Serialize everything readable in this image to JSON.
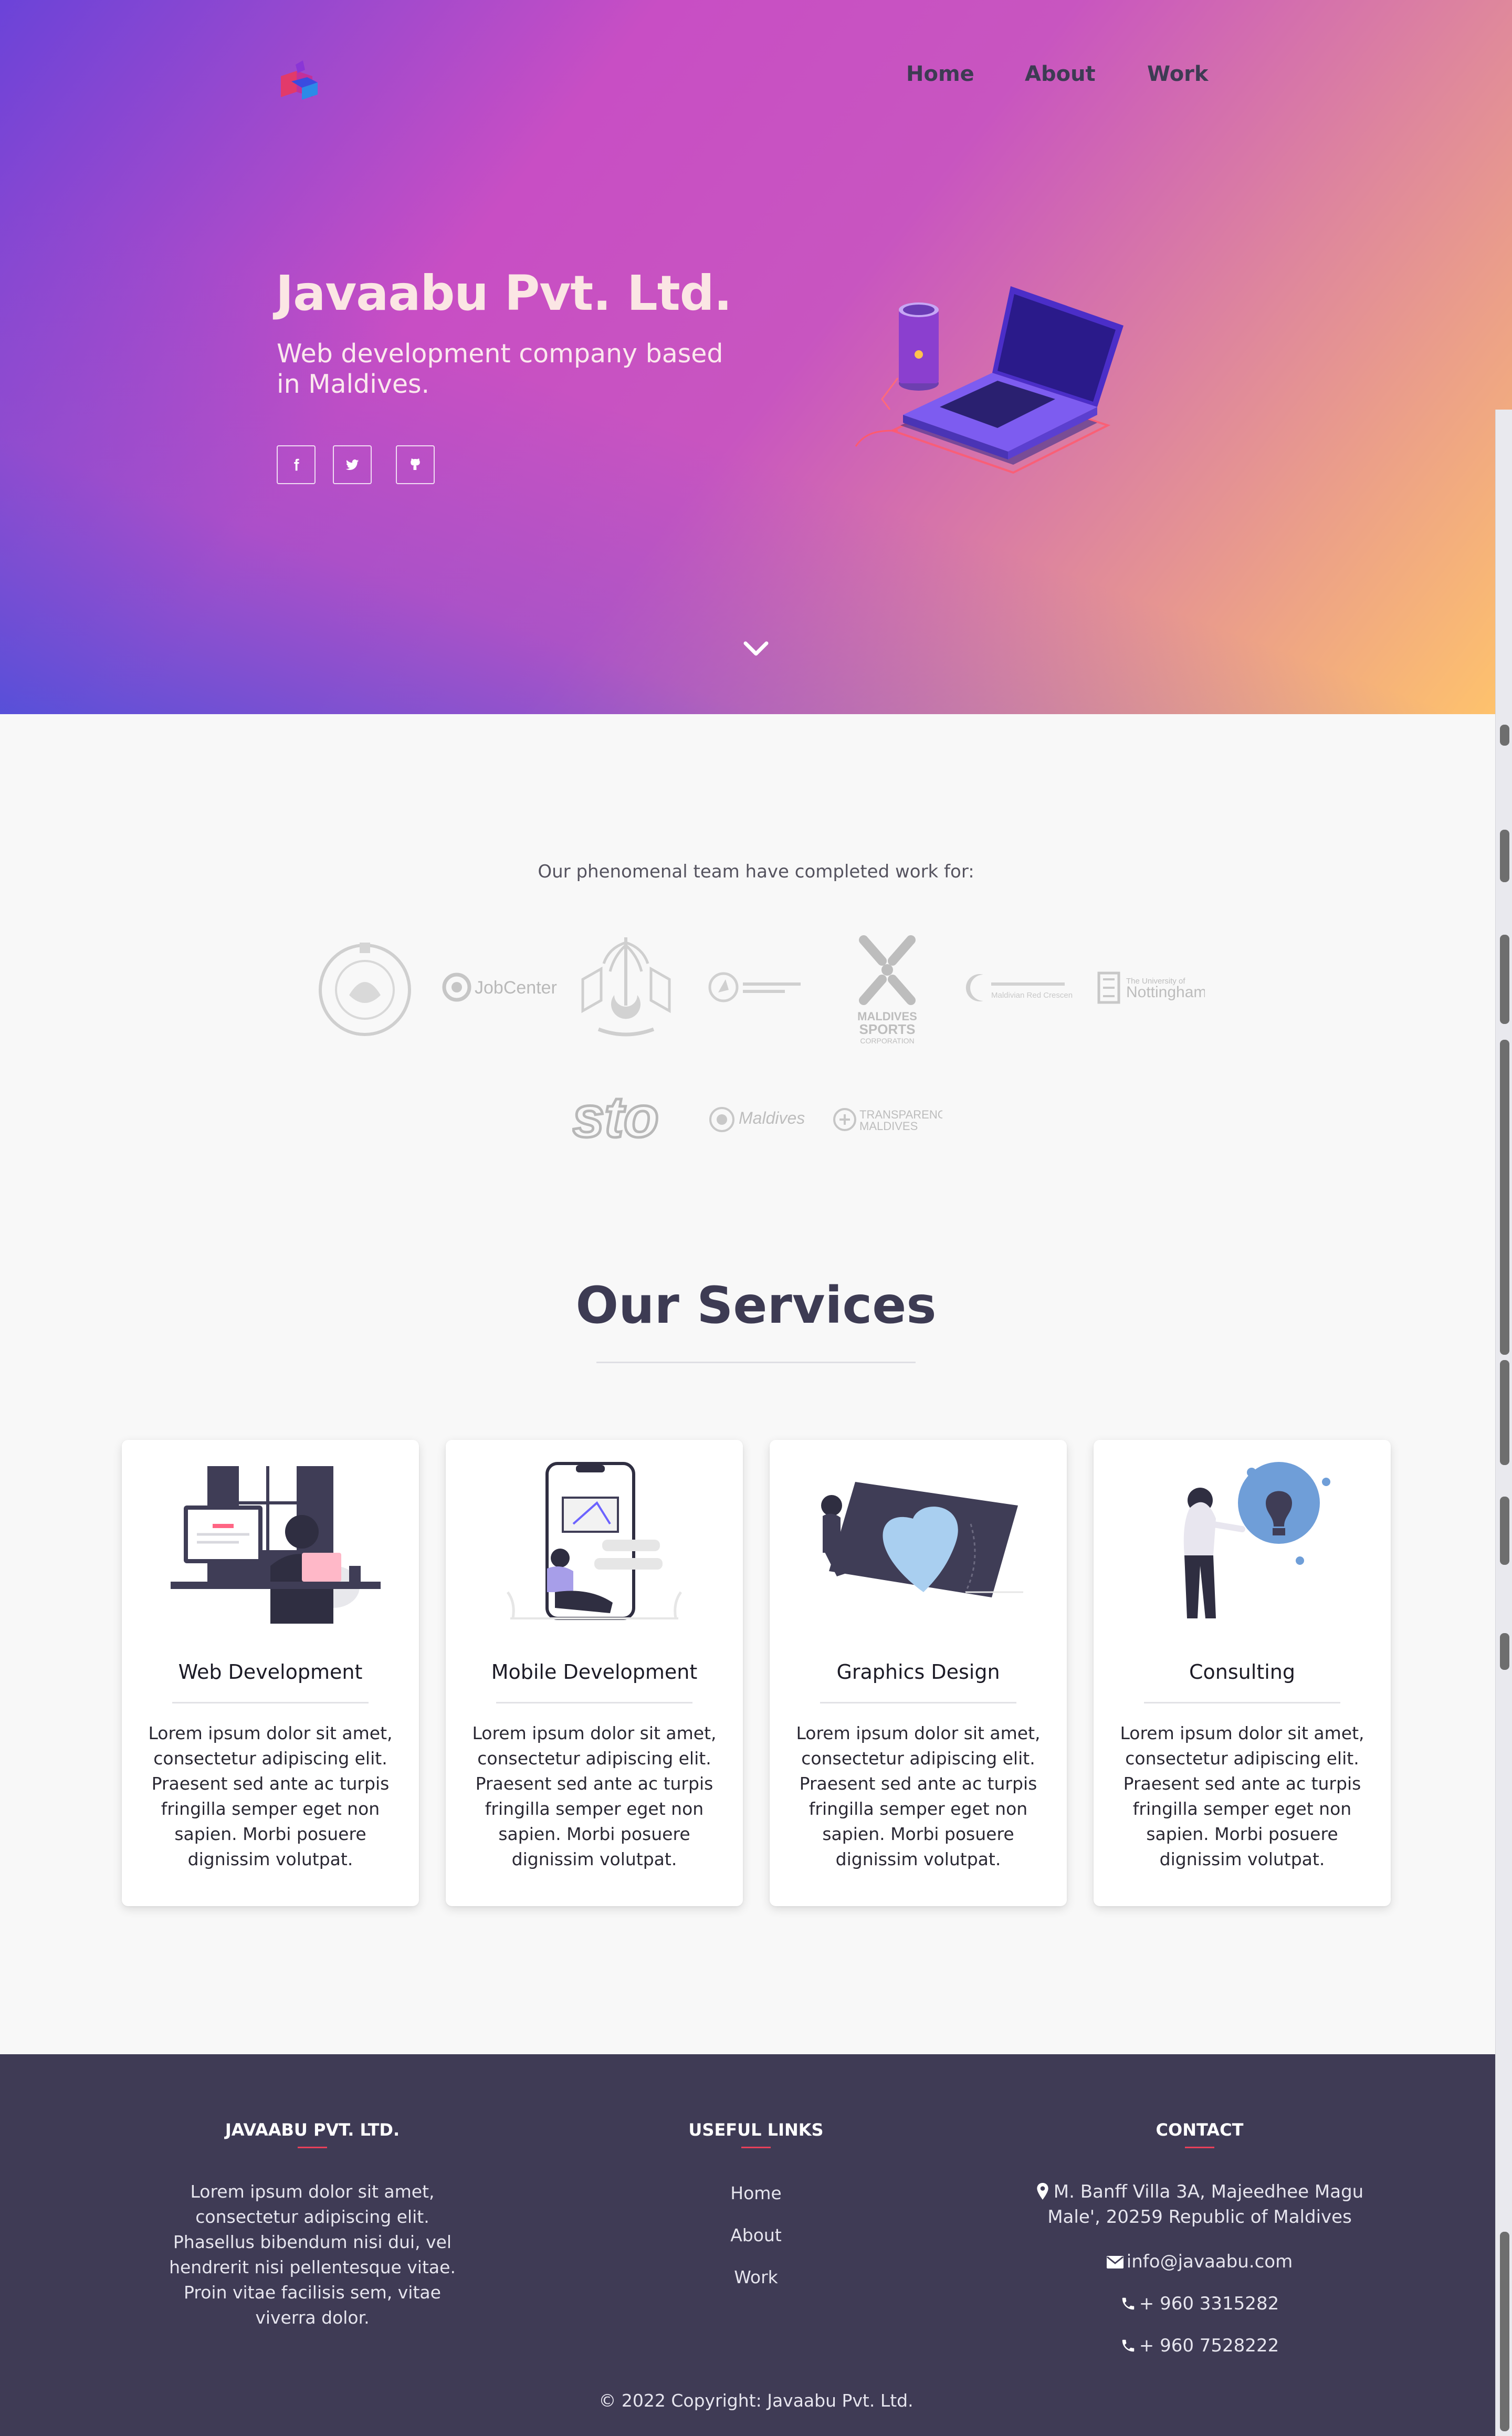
{
  "header": {
    "logo_icon": "javaabu-logo-icon",
    "nav": [
      "Home",
      "About",
      "Work"
    ]
  },
  "hero": {
    "title": "Javaabu Pvt. Ltd.",
    "subtitle": "Web development company based in Maldives.",
    "social": [
      "facebook-icon",
      "twitter-icon",
      "github-icon"
    ]
  },
  "clients": {
    "intro": "Our phenomenal team have completed work for:",
    "logos": [
      {
        "name": "seal-logo"
      },
      {
        "name": "jobcenter-logo",
        "text": "JobCenter"
      },
      {
        "name": "maldives-emblem-logo"
      },
      {
        "name": "maldives-post-logo"
      },
      {
        "name": "maldives-sports-corporation-logo",
        "text": "MALDIVES SPORTS CORPORATION"
      },
      {
        "name": "maldivian-red-crescent-logo",
        "text": "Maldivian Red Crescent"
      },
      {
        "name": "university-of-nottingham-logo",
        "text": "Nottingham"
      },
      {
        "name": "sto-logo",
        "text": "sto"
      },
      {
        "name": "visit-maldives-logo",
        "text": "Maldives"
      },
      {
        "name": "transparency-maldives-logo",
        "text": "TRANSPARENCY MALDIVES"
      }
    ]
  },
  "services": {
    "title": "Our Services",
    "items": [
      {
        "title": "Web Development",
        "text": "Lorem ipsum dolor sit amet, consectetur adipiscing elit. Praesent sed ante ac turpis fringilla semper eget non sapien. Morbi posuere dignissim volutpat."
      },
      {
        "title": "Mobile Development",
        "text": "Lorem ipsum dolor sit amet, consectetur adipiscing elit. Praesent sed ante ac turpis fringilla semper eget non sapien. Morbi posuere dignissim volutpat."
      },
      {
        "title": "Graphics Design",
        "text": "Lorem ipsum dolor sit amet, consectetur adipiscing elit. Praesent sed ante ac turpis fringilla semper eget non sapien. Morbi posuere dignissim volutpat."
      },
      {
        "title": "Consulting",
        "text": "Lorem ipsum dolor sit amet, consectetur adipiscing elit. Praesent sed ante ac turpis fringilla semper eget non sapien. Morbi posuere dignissim volutpat."
      }
    ]
  },
  "footer": {
    "company_heading": "JAVAABU PVT. LTD.",
    "company_text": "Lorem ipsum dolor sit amet, consectetur adipiscing elit. Phasellus bibendum nisi dui, vel hendrerit nisi pellentesque vitae. Proin vitae facilisis sem, vitae viverra dolor.",
    "links_heading": "USEFUL LINKS",
    "links": [
      "Home",
      "About",
      "Work"
    ],
    "contact_heading": "CONTACT",
    "address": "M. Banff Villa 3A, Majeedhee Magu Male', 20259 Republic of Maldives",
    "email": "info@javaabu.com",
    "phone1": "+ 960 3315282",
    "phone2": "+ 960 7528222",
    "copyright": "© 2022 Copyright: Javaabu Pvt. Ltd."
  },
  "colors": {
    "brand_dark": "#3d3b53",
    "footer_bg": "#3f3b55",
    "accent_red": "#e8405a"
  }
}
